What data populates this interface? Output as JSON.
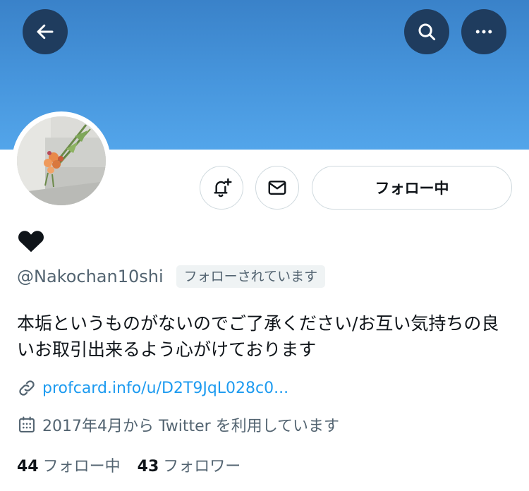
{
  "profile": {
    "display_name": "❤",
    "handle": "@Nakochan10shi",
    "follows_you_badge": "フォローされています",
    "bio": "本垢というものがないのでご了承ください/お互い気持ちの良いお取引出来るよう心がけております",
    "link": "profcard.info/u/D2T9JqL028c0...",
    "joined": "2017年4月から Twitter を利用しています"
  },
  "actions": {
    "follow_label": "フォロー中"
  },
  "stats": {
    "following_count": "44",
    "following_label": "フォロー中",
    "followers_count": "43",
    "followers_label": "フォロワー"
  },
  "icons": {
    "back": "arrow-left-icon",
    "search": "search-icon",
    "more": "more-horizontal-icon",
    "notify": "bell-plus-icon",
    "message": "mail-icon",
    "link": "link-icon",
    "calendar": "calendar-icon"
  },
  "colors": {
    "banner": "#4796dd",
    "header_button": "#1f3c5e",
    "link": "#1d9bf0",
    "secondary_text": "#536471"
  }
}
